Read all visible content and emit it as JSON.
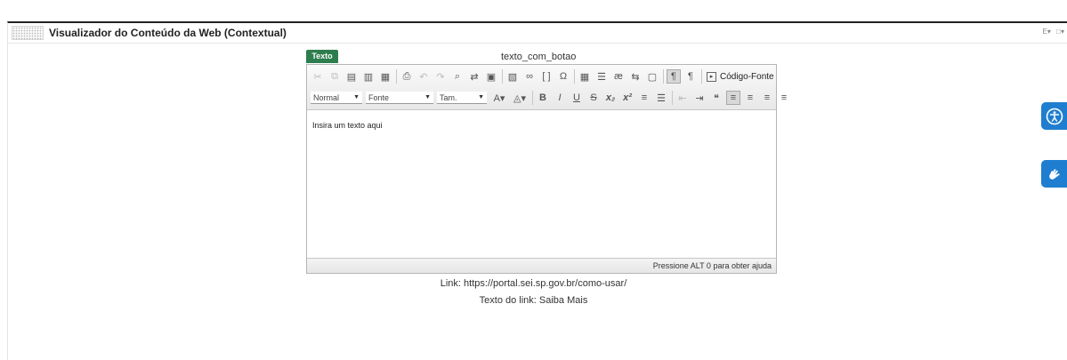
{
  "portlet": {
    "title": "Visualizador do Conteúdo da Web (Contextual)",
    "menu_left": "E▾",
    "menu_right": "□▾"
  },
  "editor": {
    "label": "Texto",
    "field_name": "texto_com_botao",
    "toolbar": {
      "source_label": "Código-Fonte",
      "format_combo": "Normal",
      "font_combo": "Fonte",
      "size_combo": "Tam."
    },
    "content_text": "Insira um texto aqui",
    "status_text": "Pressione ALT 0 para obter ajuda"
  },
  "link_info": {
    "link": "Link: https://portal.sei.sp.gov.br/como-usar/",
    "link_text": "Texto do link: Saiba Mais"
  },
  "side_widgets": {
    "accessibility_icon": "accessibility-icon",
    "sign_language_icon": "sign-language-icon"
  }
}
